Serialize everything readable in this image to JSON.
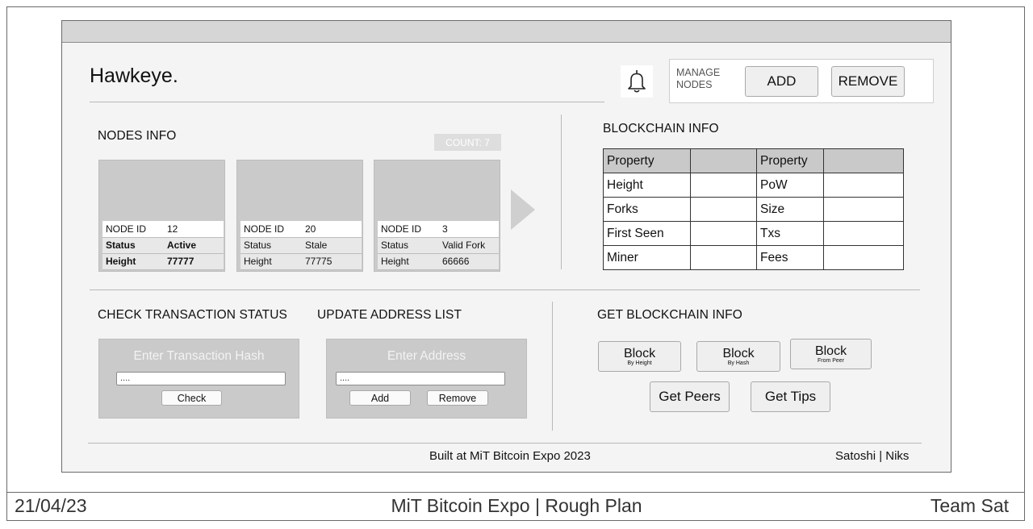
{
  "header": {
    "brand": "Hawkeye.",
    "manage_label": "MANAGE NODES",
    "add_label": "ADD",
    "remove_label": "REMOVE"
  },
  "nodes_info": {
    "title": "NODES INFO",
    "count_label": "COUNT: 7",
    "nodes": [
      {
        "id_label": "NODE ID",
        "id": "12",
        "status_label": "Status",
        "status": "Active",
        "height_label": "Height",
        "height": "77777"
      },
      {
        "id_label": "NODE ID",
        "id": "20",
        "status_label": "Status",
        "status": "Stale",
        "height_label": "Height",
        "height": "77775"
      },
      {
        "id_label": "NODE ID",
        "id": "3",
        "status_label": "Status",
        "status": "Valid Fork",
        "height_label": "Height",
        "height": "66666"
      }
    ]
  },
  "blockchain_info": {
    "title": "BLOCKCHAIN INFO",
    "rows": [
      [
        "Property",
        "",
        "Property",
        ""
      ],
      [
        "Height",
        "",
        "PoW",
        ""
      ],
      [
        "Forks",
        "",
        "Size",
        ""
      ],
      [
        "First Seen",
        "",
        "Txs",
        ""
      ],
      [
        "Miner",
        "",
        "Fees",
        ""
      ]
    ]
  },
  "check_tx": {
    "title": "CHECK TRANSACTION STATUS",
    "placeholder": "Enter Transaction Hash",
    "input_value": "....",
    "check_label": "Check"
  },
  "update_addr": {
    "title": "UPDATE ADDRESS LIST",
    "placeholder": "Enter Address",
    "input_value": "....",
    "add_label": "Add",
    "remove_label": "Remove"
  },
  "get_info": {
    "title": "GET BLOCKCHAIN INFO",
    "block_height": {
      "main": "Block",
      "sub": "By Height"
    },
    "block_hash": {
      "main": "Block",
      "sub": "By Hash"
    },
    "block_peer": {
      "main": "Block",
      "sub": "From Peer"
    },
    "peers_label": "Get Peers",
    "tips_label": "Get Tips"
  },
  "app_footer": {
    "built": "Built at MiT Bitcoin Expo 2023",
    "credits": "Satoshi | Niks"
  },
  "sheet_footer": {
    "date": "21/04/23",
    "title": "MiT Bitcoin Expo | Rough Plan",
    "team": "Team Sat"
  }
}
